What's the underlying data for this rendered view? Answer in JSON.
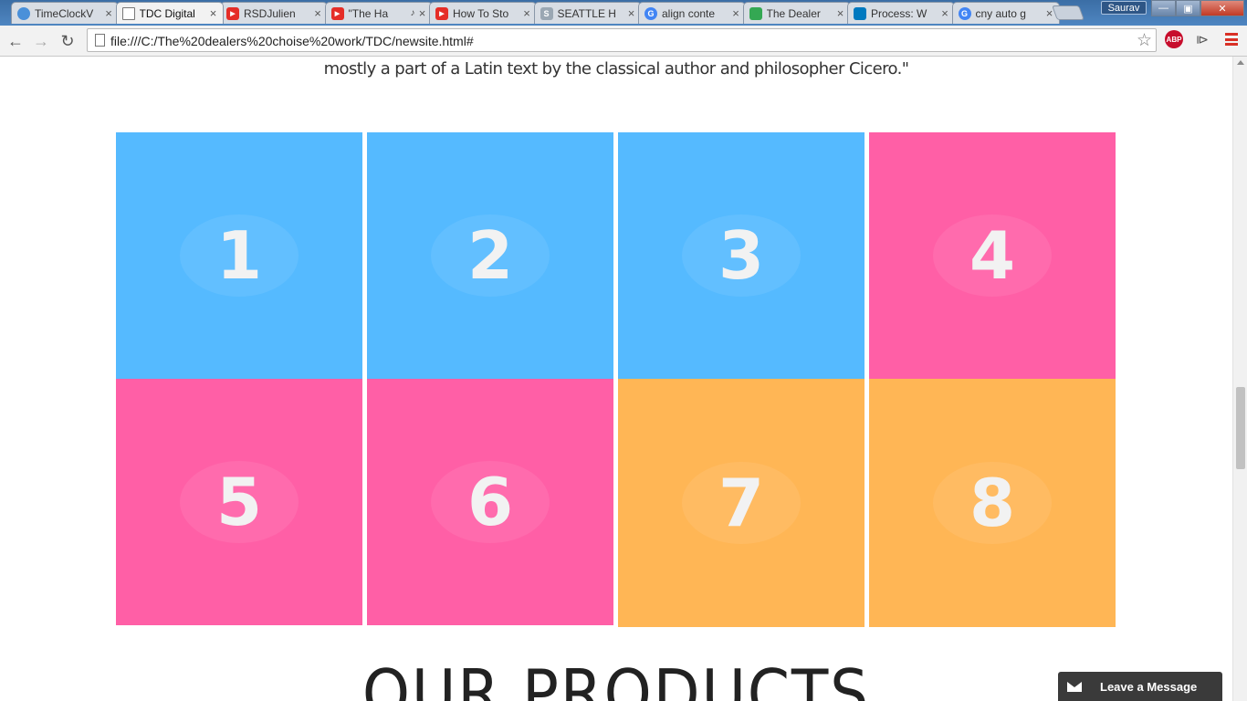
{
  "browser": {
    "tabs": [
      {
        "label": "TimeClockV",
        "favicon": "globe-icon",
        "color": "#4a90d9",
        "active": false
      },
      {
        "label": "TDC Digital",
        "favicon": "page-icon",
        "color": "#ffffff",
        "active": true
      },
      {
        "label": "RSDJulien",
        "favicon": "youtube-icon",
        "color": "#e52d27",
        "active": false
      },
      {
        "label": "\"The Ha",
        "favicon": "youtube-icon",
        "color": "#e52d27",
        "active": false,
        "audio": true
      },
      {
        "label": "How To Sto",
        "favicon": "youtube-icon",
        "color": "#e52d27",
        "active": false
      },
      {
        "label": "SEATTLE H",
        "favicon": "s-icon",
        "color": "#9aa7b3",
        "active": false
      },
      {
        "label": "align conte",
        "favicon": "google-icon",
        "color": "#4285f4",
        "active": false
      },
      {
        "label": "The Dealer",
        "favicon": "maps-icon",
        "color": "#34a853",
        "active": false
      },
      {
        "label": "Process: W",
        "favicon": "trello-icon",
        "color": "#0079bf",
        "active": false
      },
      {
        "label": "cny auto g",
        "favicon": "google-icon",
        "color": "#4285f4",
        "active": false
      }
    ],
    "profile_name": "Saurav",
    "url": "file:///C:/The%20dealers%20choise%20work/TDC/newsite.html#",
    "abp_label": "ABP"
  },
  "page": {
    "intro_text": "mostly a part of a Latin text by the classical author and philosopher Cicero.\"",
    "tiles": [
      {
        "number": "1",
        "color": "#55baff"
      },
      {
        "number": "2",
        "color": "#55baff"
      },
      {
        "number": "3",
        "color": "#55baff"
      },
      {
        "number": "4",
        "color": "#ff5fa6"
      },
      {
        "number": "5",
        "color": "#ff5fa6"
      },
      {
        "number": "6",
        "color": "#ff5fa6"
      },
      {
        "number": "7",
        "color": "#ffb655"
      },
      {
        "number": "8",
        "color": "#ffb655"
      }
    ],
    "section_title": "OUR PRODUCTS"
  },
  "chat": {
    "label": "Leave a Message",
    "icon": "mail-icon"
  }
}
